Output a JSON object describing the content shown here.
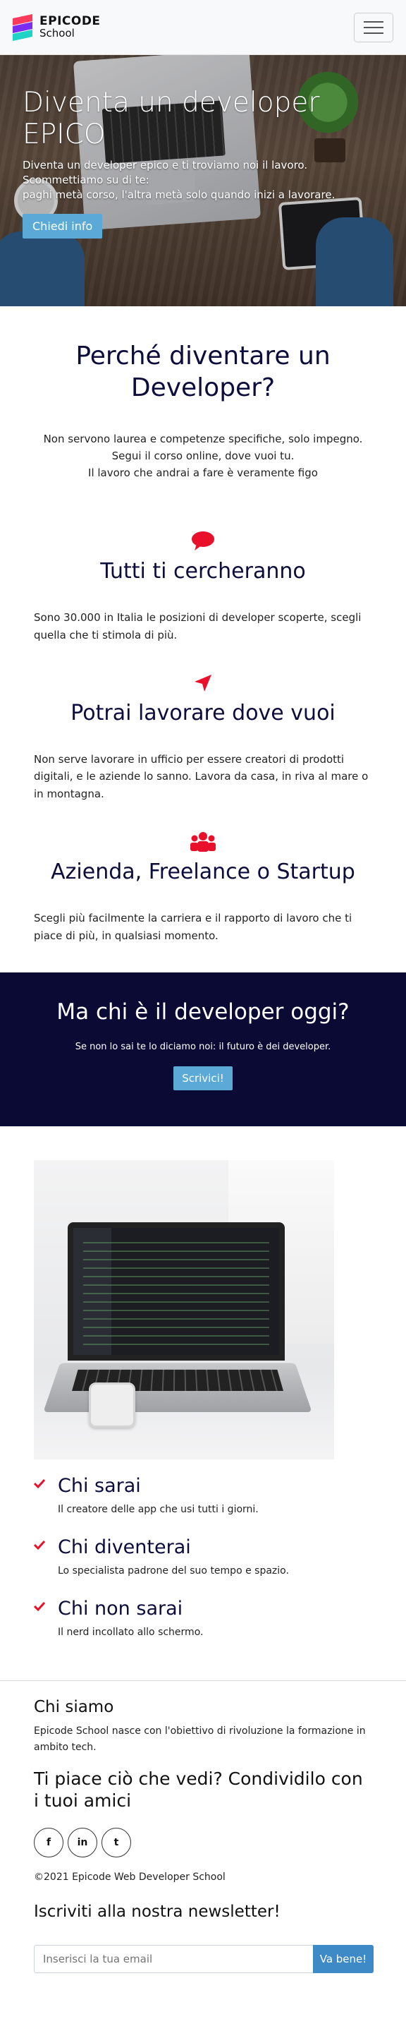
{
  "brand": {
    "name": "EPICODE",
    "sub": "School"
  },
  "hero": {
    "title": "Diventa un developer EPICO",
    "text_line1": "Diventa un developer epico e ti troviamo noi il lavoro. Scommettiamo su di te:",
    "text_line2": "paghi metà corso, l'altra metà solo quando inizi a lavorare.",
    "button": "Chiedi info"
  },
  "why": {
    "title": "Perché diventare un Developer?",
    "lines": [
      "Non servono laurea e competenze specifiche, solo impegno.",
      "Segui il corso online, dove vuoi tu.",
      "Il lavoro che andrai a fare è veramente figo"
    ]
  },
  "features": [
    {
      "icon": "chat-bubble-icon",
      "title": "Tutti ti cercheranno",
      "text": "Sono 30.000 in Italia le posizioni di developer scoperte, scegli quella che ti stimola di più."
    },
    {
      "icon": "location-arrow-icon",
      "title": "Potrai lavorare dove vuoi",
      "text": "Non serve lavorare in ufficio per essere creatori di prodotti digitali, e le aziende lo sanno. Lavora da casa, in riva al mare o in montagna."
    },
    {
      "icon": "users-icon",
      "title": "Azienda, Freelance o Startup",
      "text": "Scegli più facilmente la carriera e il rapporto di lavoro che ti piace di più, in qualsiasi momento."
    }
  ],
  "band": {
    "title": "Ma chi è il developer oggi?",
    "text": "Se non lo sai te lo diciamo noi: il futuro è dei developer.",
    "button": "Scrivici!"
  },
  "points": [
    {
      "title": "Chi sarai",
      "text": "Il creatore delle app che usi tutti i giorni."
    },
    {
      "title": "Chi diventerai",
      "text": "Lo specialista padrone del suo tempo e spazio."
    },
    {
      "title": "Chi non sarai",
      "text": "Il nerd incollato allo schermo."
    }
  ],
  "footer": {
    "about_title": "Chi siamo",
    "about_text": "Epicode School nasce con l'obiettivo di rivoluzione la formazione in ambito tech.",
    "share": "Ti piace ciò che vedi? Condividilo con i tuoi amici",
    "socials": [
      {
        "name": "facebook-icon",
        "glyph": "f"
      },
      {
        "name": "linkedin-icon",
        "glyph": "in"
      },
      {
        "name": "twitter-icon",
        "glyph": "t"
      }
    ],
    "copyright": "©2021 Epicode Web Developer School",
    "newsletter_title": "Iscriviti alla nostra newsletter!",
    "newsletter_placeholder": "Inserisci la tua email",
    "newsletter_button": "Va bene!"
  },
  "colors": {
    "accent_red": "#e8102a",
    "navy": "#0b0a35",
    "button_blue": "#5aa9d6"
  }
}
